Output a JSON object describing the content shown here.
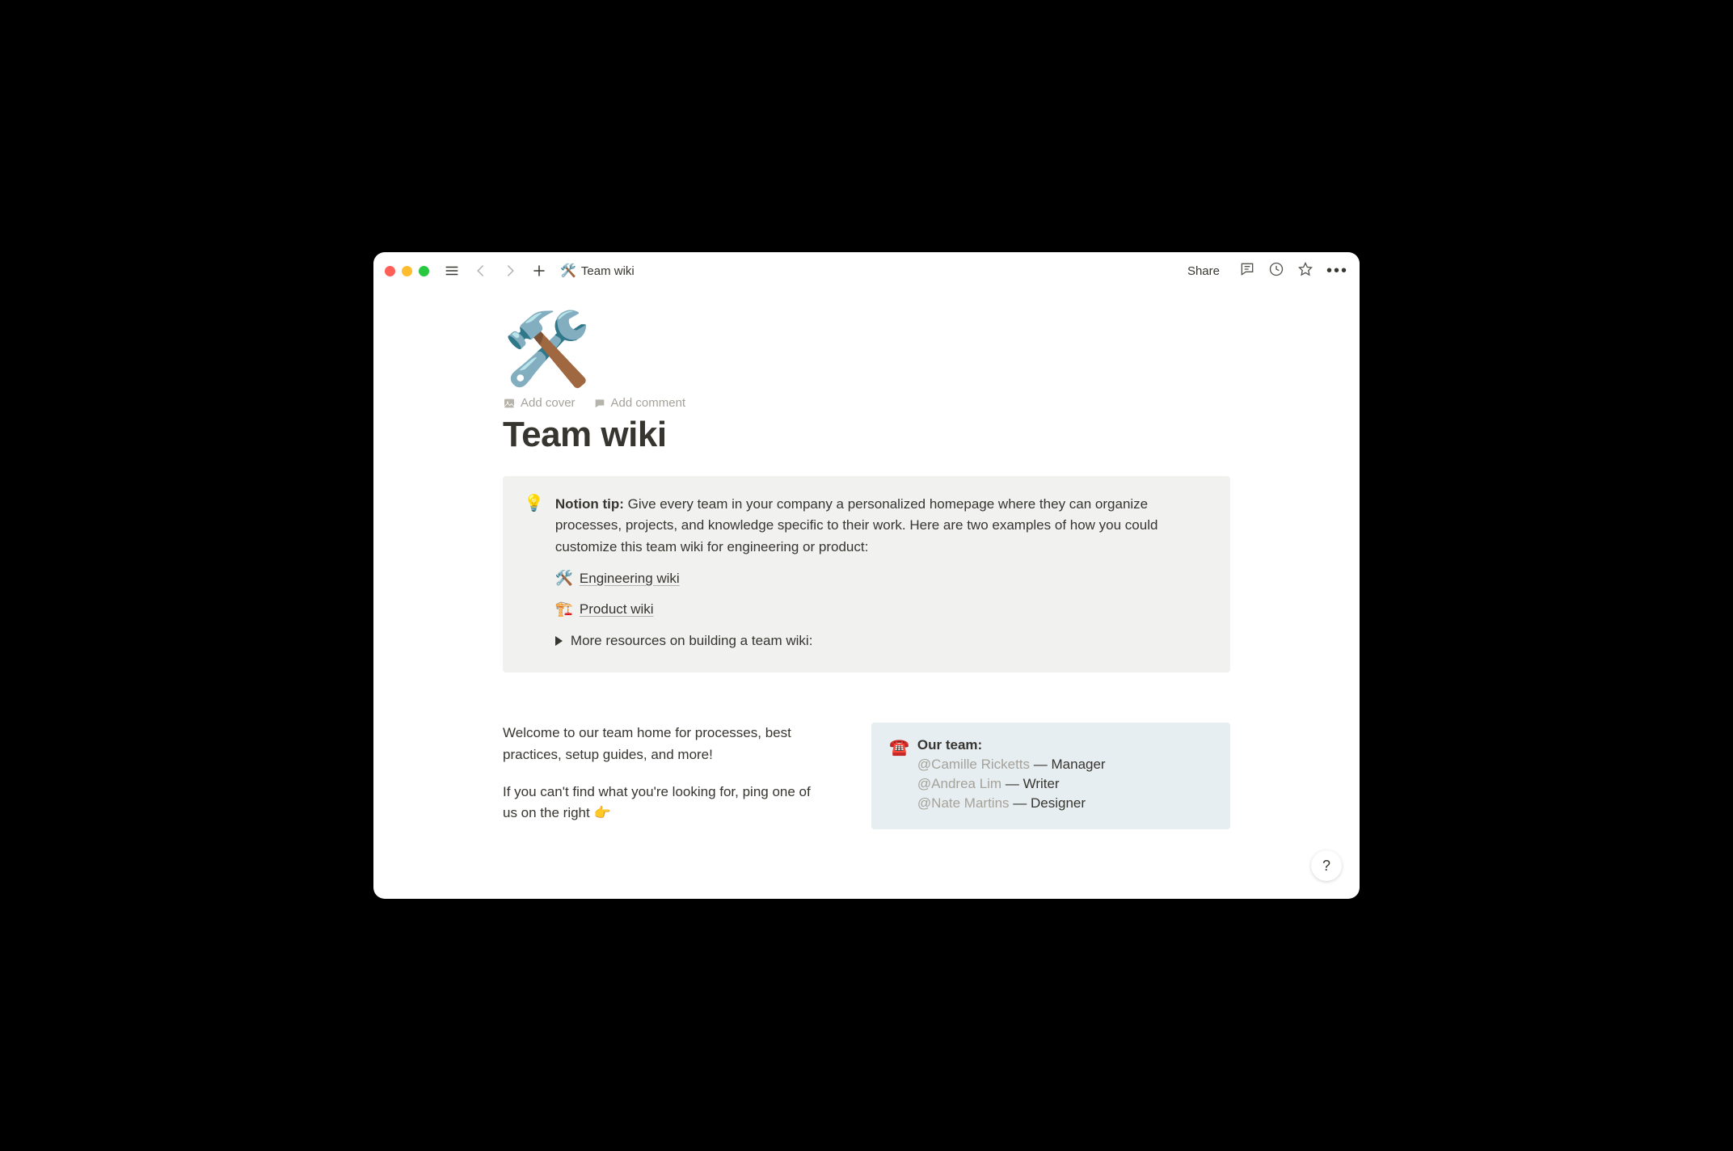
{
  "breadcrumb": {
    "icon": "🛠️",
    "title": "Team wiki"
  },
  "toolbar": {
    "share": "Share"
  },
  "page": {
    "emoji": "🛠️",
    "add_cover": "Add cover",
    "add_comment": "Add comment",
    "title": "Team wiki"
  },
  "callout": {
    "bulb": "💡",
    "tip_label": "Notion tip:",
    "tip_body": "Give every team in your company a personalized homepage where they can organize processes, projects, and knowledge specific to their work. Here are two examples of how you could customize this team wiki for engineering or product:",
    "links": [
      {
        "emoji": "🛠️",
        "label": "Engineering wiki"
      },
      {
        "emoji": "🏗️",
        "label": "Product wiki"
      }
    ],
    "toggle": "More resources on building a team wiki:"
  },
  "body": {
    "welcome1": "Welcome to our team home for processes, best practices, setup guides, and more!",
    "welcome2_pre": "If you can't find what you're looking for, ping one of us on the right ",
    "pointer": "👉"
  },
  "team_block": {
    "icon": "☎️",
    "heading": "Our team:",
    "members": [
      {
        "mention": "@Camille Ricketts",
        "role": "Manager"
      },
      {
        "mention": "@Andrea Lim",
        "role": "Writer"
      },
      {
        "mention": "@Nate Martins",
        "role": "Designer"
      }
    ]
  },
  "help": "?"
}
